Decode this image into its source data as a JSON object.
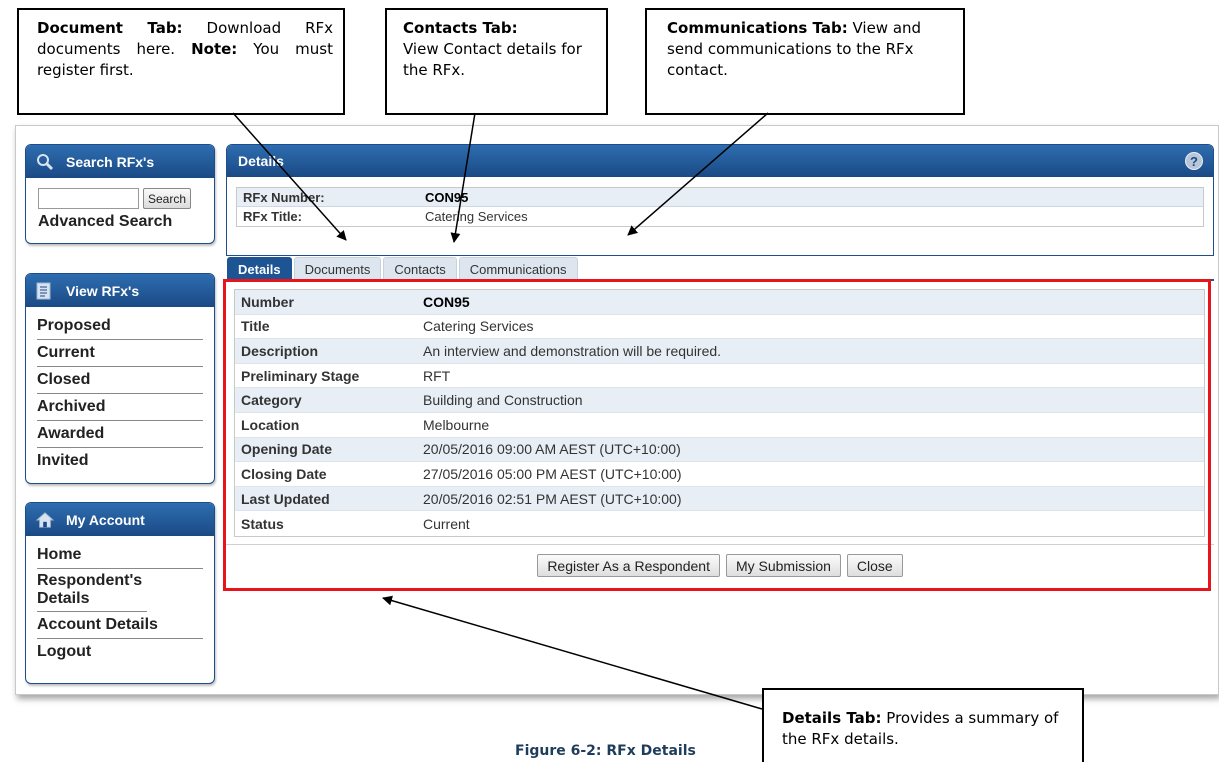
{
  "callouts": {
    "document": {
      "bold": "Document Tab:",
      "text": " Download RFx documents here. ",
      "note_bold": "Note:",
      "note_text": " You must register first."
    },
    "contacts": {
      "bold": "Contacts Tab:",
      "text": "View Contact details for the RFx."
    },
    "communications": {
      "bold": "Communications Tab:",
      "text": " View and send communications to the RFx contact."
    },
    "details": {
      "bold": "Details Tab:",
      "text": " Provides a summary of the RFx details."
    }
  },
  "sidebar": {
    "search": {
      "title": "Search RFx's",
      "input_value": "",
      "button": "Search",
      "advanced": "Advanced Search"
    },
    "view": {
      "title": "View RFx's",
      "items": [
        "Proposed",
        "Current",
        "Closed",
        "Archived",
        "Awarded",
        "Invited"
      ]
    },
    "account": {
      "title": "My Account",
      "items": [
        "Home",
        "Respondent's Details",
        "Account Details",
        "Logout"
      ]
    }
  },
  "main": {
    "title": "Details",
    "help": "?",
    "summary": [
      {
        "label": "RFx Number:",
        "value": "CON95"
      },
      {
        "label": "RFx Title:",
        "value": "Catering Services"
      }
    ],
    "tabs": [
      "Details",
      "Documents",
      "Contacts",
      "Communications"
    ],
    "active_tab": "Details",
    "details": [
      {
        "label": "Number",
        "value": "CON95"
      },
      {
        "label": "Title",
        "value": "Catering Services"
      },
      {
        "label": "Description",
        "value": "An interview and demonstration will be required."
      },
      {
        "label": "Preliminary Stage",
        "value": "RFT"
      },
      {
        "label": "Category",
        "value": "Building and Construction"
      },
      {
        "label": "Location",
        "value": "Melbourne"
      },
      {
        "label": "Opening Date",
        "value": "20/05/2016 09:00 AM AEST (UTC+10:00)"
      },
      {
        "label": "Closing Date",
        "value": "27/05/2016 05:00 PM AEST (UTC+10:00)"
      },
      {
        "label": "Last Updated",
        "value": "20/05/2016 02:51 PM AEST (UTC+10:00)"
      },
      {
        "label": "Status",
        "value": "Current"
      }
    ],
    "buttons": [
      "Register As a Respondent",
      "My Submission",
      "Close"
    ]
  },
  "caption": "Figure 6-2: RFx Details",
  "colors": {
    "header_blue": "#1d5493",
    "highlight_red": "#e8141c",
    "row_alt": "#e8eef5"
  }
}
